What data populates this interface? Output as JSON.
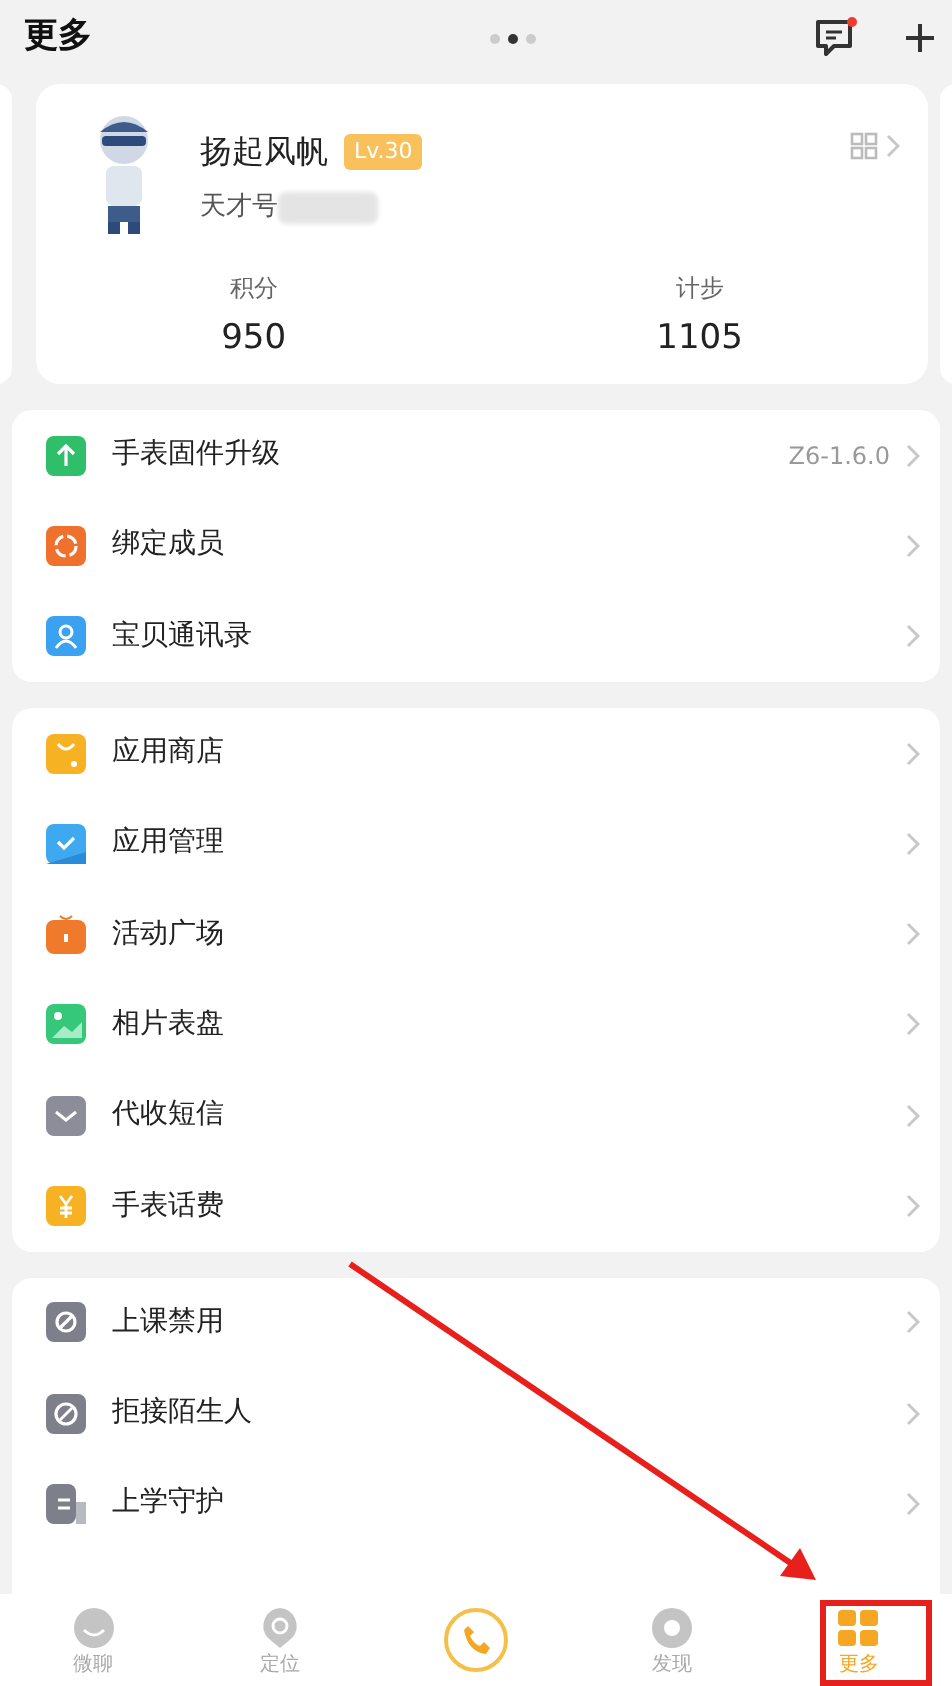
{
  "header": {
    "title": "更多",
    "pager_dots": [
      {
        "selected": false
      },
      {
        "selected": true
      },
      {
        "selected": false
      }
    ],
    "messages_unread": true
  },
  "profile": {
    "name": "扬起风帆",
    "level_badge": "Lv.30",
    "id_label": "天才号",
    "stats": [
      {
        "label": "积分",
        "value": "950"
      },
      {
        "label": "计步",
        "value": "1105"
      }
    ]
  },
  "sections": [
    {
      "items": [
        {
          "label": "手表固件升级",
          "kind": "upload",
          "color": "#2fbf6a",
          "value": "Z6-1.6.0"
        },
        {
          "label": "绑定成员",
          "kind": "members",
          "color": "#f0712e"
        },
        {
          "label": "宝贝通讯录",
          "kind": "contact",
          "color": "#3aa2f0"
        }
      ]
    },
    {
      "items": [
        {
          "label": "应用商店",
          "kind": "store",
          "color": "#f7b224"
        },
        {
          "label": "应用管理",
          "kind": "manage",
          "color": "#3fa9f0"
        },
        {
          "label": "活动广场",
          "kind": "gift",
          "color": "#f07a2c"
        },
        {
          "label": "相片表盘",
          "kind": "photo",
          "color": "#35c77a"
        },
        {
          "label": "代收短信",
          "kind": "mail",
          "color": "#8d8d9a"
        },
        {
          "label": "手表话费",
          "kind": "fee",
          "color": "#f7b224"
        }
      ]
    },
    {
      "items": [
        {
          "label": "上课禁用",
          "kind": "ban",
          "color": "#7d7f8a"
        },
        {
          "label": "拒接陌生人",
          "kind": "reject",
          "color": "#7d7f8a"
        },
        {
          "label": "上学守护",
          "kind": "school",
          "color": "#7d7f8a"
        }
      ]
    }
  ],
  "tab_bar": {
    "tabs": [
      {
        "kind": "chat",
        "label": "微聊",
        "selected": false
      },
      {
        "kind": "locate",
        "label": "定位",
        "selected": false
      },
      {
        "kind": "call"
      },
      {
        "kind": "discover",
        "label": "发现",
        "selected": false
      },
      {
        "kind": "more",
        "label": "更多",
        "selected": true
      }
    ]
  }
}
